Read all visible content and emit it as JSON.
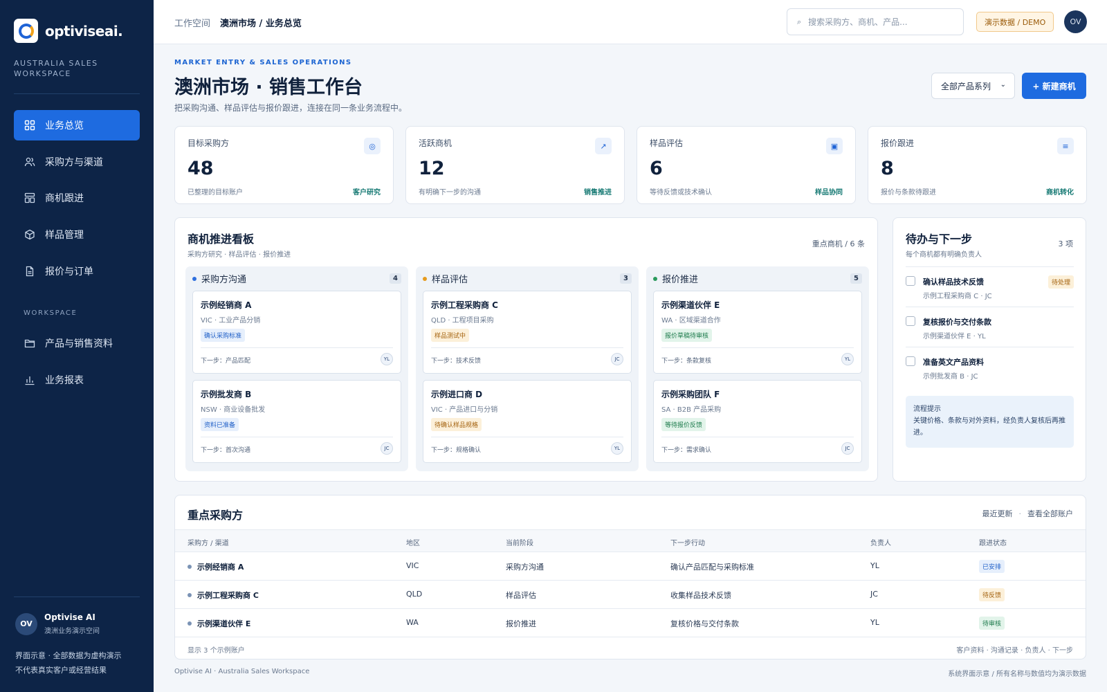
{
  "brand": {
    "name": "optiviseai.",
    "workspace": "AUSTRALIA SALES WORKSPACE"
  },
  "nav": {
    "items": [
      {
        "label": "业务总览"
      },
      {
        "label": "采购方与渠道"
      },
      {
        "label": "商机跟进"
      },
      {
        "label": "样品管理"
      },
      {
        "label": "报价与订单"
      }
    ],
    "section": "WORKSPACE",
    "section_items": [
      {
        "label": "产品与销售资料"
      },
      {
        "label": "业务报表"
      }
    ]
  },
  "user": {
    "initials": "OV",
    "name": "Optivise AI",
    "sub": "澳洲业务演示空间"
  },
  "sidebar_note": {
    "line1": "界面示意 · 全部数据为虚构演示",
    "line2": "不代表真实客户或经营结果"
  },
  "topbar": {
    "crumb_root": "工作空间",
    "crumb_current": "澳洲市场 / 业务总览",
    "search_placeholder": "搜索采购方、商机、产品...",
    "demo_badge": "演示数据 / DEMO",
    "avatar": "OV"
  },
  "header": {
    "eyebrow": "MARKET ENTRY & SALES OPERATIONS",
    "title": "澳洲市场 · 销售工作台",
    "subtitle": "把采购沟通、样品评估与报价跟进，连接在同一条业务流程中。",
    "filter": "全部产品系列",
    "new_button": "+ 新建商机"
  },
  "stats": [
    {
      "label": "目标采购方",
      "value": "48",
      "desc": "已整理的目标账户",
      "tag": "客户研究",
      "icon": "target-icon"
    },
    {
      "label": "活跃商机",
      "value": "12",
      "desc": "有明确下一步的沟通",
      "tag": "销售推进",
      "icon": "arrow-up-right-icon"
    },
    {
      "label": "样品评估",
      "value": "6",
      "desc": "等待反馈或技术确认",
      "tag": "样品协同",
      "icon": "box-icon"
    },
    {
      "label": "报价跟进",
      "value": "8",
      "desc": "报价与条款待跟进",
      "tag": "商机转化",
      "icon": "list-icon"
    }
  ],
  "kanban": {
    "title": "商机推进看板",
    "subtitle": "采购方研究 · 样品评估 · 报价推进",
    "meta": "重点商机 / 6 条",
    "columns": [
      {
        "title": "采购方沟通",
        "count": "4",
        "color": "#2f6fde",
        "cards": [
          {
            "name": "示例经销商 A",
            "meta": "VIC · 工业产品分销",
            "tag": "确认采购标准",
            "next": "下一步：产品匹配",
            "owner": "YL"
          },
          {
            "name": "示例批发商 B",
            "meta": "NSW · 商业设备批发",
            "tag": "资料已准备",
            "next": "下一步：首次沟通",
            "owner": "JC"
          }
        ]
      },
      {
        "title": "样品评估",
        "count": "3",
        "color": "#e69b1e",
        "cards": [
          {
            "name": "示例工程采购商 C",
            "meta": "QLD · 工程项目采购",
            "tag": "样品测试中",
            "next": "下一步：技术反馈",
            "owner": "JC"
          },
          {
            "name": "示例进口商 D",
            "meta": "VIC · 产品进口与分销",
            "tag": "待确认样品规格",
            "next": "下一步：规格确认",
            "owner": "YL"
          }
        ]
      },
      {
        "title": "报价推进",
        "count": "5",
        "color": "#2a9a5c",
        "cards": [
          {
            "name": "示例渠道伙伴 E",
            "meta": "WA · 区域渠道合作",
            "tag": "报价草稿待审核",
            "next": "下一步：条款复核",
            "owner": "YL"
          },
          {
            "name": "示例采购团队 F",
            "meta": "SA · B2B 产品采购",
            "tag": "等待报价反馈",
            "next": "下一步：需求确认",
            "owner": "JC"
          }
        ]
      }
    ]
  },
  "todo": {
    "title": "待办与下一步",
    "subtitle": "每个商机都有明确负责人",
    "count": "3 项",
    "items": [
      {
        "title": "确认样品技术反馈",
        "sub": "示例工程采购商 C · JC",
        "badge": "待处理"
      },
      {
        "title": "复核报价与交付条款",
        "sub": "示例渠道伙伴 E · YL"
      },
      {
        "title": "准备英文产品资料",
        "sub": "示例批发商 B · JC"
      }
    ],
    "tip_title": "流程提示",
    "tip_body": "关键价格、条款与对外资料，经负责人复核后再推进。"
  },
  "table": {
    "title": "重点采购方",
    "link_recent": "最近更新",
    "link_all": "查看全部账户",
    "headers": [
      "采购方 / 渠道",
      "地区",
      "当前阶段",
      "下一步行动",
      "负责人",
      "跟进状态"
    ],
    "rows": [
      {
        "name": "示例经销商 A",
        "region": "VIC",
        "stage": "采购方沟通",
        "next": "确认产品匹配与采购标准",
        "owner": "YL",
        "status": "已安排"
      },
      {
        "name": "示例工程采购商 C",
        "region": "QLD",
        "stage": "样品评估",
        "next": "收集样品技术反馈",
        "owner": "JC",
        "status": "待反馈"
      },
      {
        "name": "示例渠道伙伴 E",
        "region": "WA",
        "stage": "报价推进",
        "next": "复核价格与交付条款",
        "owner": "YL",
        "status": "待审核"
      }
    ],
    "footer_left": "显示 3 个示例账户",
    "footer_right": "客户资料 · 沟通记录 · 负责人 · 下一步"
  },
  "footer": {
    "left": "Optivise AI · Australia Sales Workspace",
    "right": "系统界面示意 / 所有名称与数值均为演示数据"
  }
}
